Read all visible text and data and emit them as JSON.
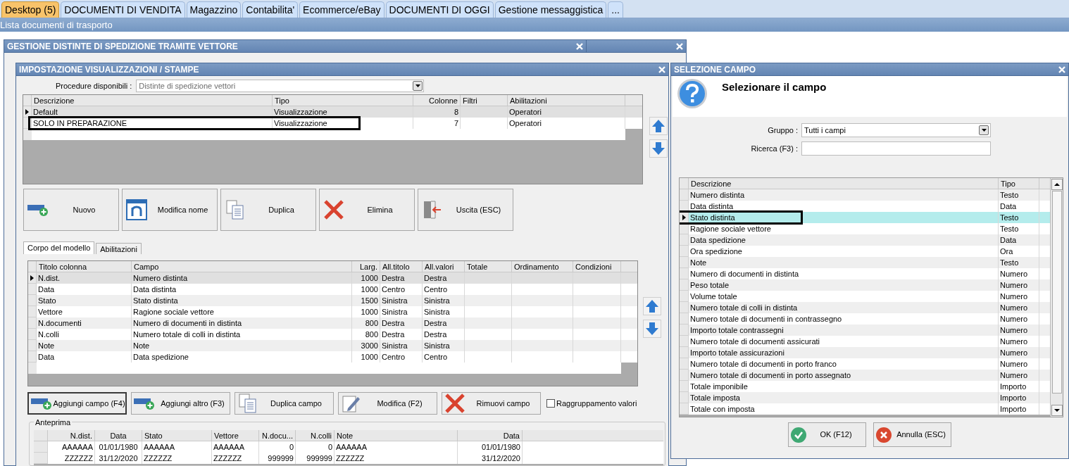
{
  "app_tabs": [
    {
      "label": "Desktop (5)",
      "selected": true
    },
    {
      "label": "DOCUMENTI DI VENDITA",
      "selected": false
    },
    {
      "label": "Magazzino",
      "selected": false
    },
    {
      "label": "Contabilita'",
      "selected": false
    },
    {
      "label": "Ecommerce/eBay",
      "selected": false
    },
    {
      "label": "DOCUMENTI DI OGGI",
      "selected": false
    },
    {
      "label": "Gestione messaggistica",
      "selected": false
    },
    {
      "label": "...",
      "selected": false
    }
  ],
  "subtitle": "Lista documenti di trasporto",
  "background_window": {
    "title": "GESTIONE DISTINTE DI SPEDIZIONE TRAMITE VETTORE"
  },
  "layout_dialog": {
    "title": "IMPOSTAZIONE VISUALIZZAZIONI / STAMPE",
    "procedure_label": "Procedure disponibili :",
    "procedure_value": "Distinte di spedizione vettori",
    "layouts": {
      "columns": [
        "Descrizione",
        "Tipo",
        "Colonne",
        "Filtri",
        "Abilitazioni"
      ],
      "rows": [
        {
          "cells": [
            "Default",
            "Visualizzazione",
            "8",
            "",
            "Operatori"
          ],
          "selected": true,
          "marked": false
        },
        {
          "cells": [
            "SOLO IN PREPARAZIONE",
            "Visualizzazione",
            "7",
            "",
            "Operatori"
          ],
          "selected": false,
          "marked": true
        }
      ]
    },
    "buttons": [
      "Nuovo",
      "Modifica nome",
      "Duplica",
      "Elimina",
      "Uscita (ESC)"
    ],
    "tabs": [
      {
        "label": "Corpo del modello",
        "selected": true
      },
      {
        "label": "Abilitazioni",
        "selected": false
      }
    ],
    "fields": {
      "columns": [
        "Titolo colonna",
        "Campo",
        "Larg.",
        "All.titolo",
        "All.valori",
        "Totale",
        "Ordinamento",
        "Condizioni"
      ],
      "rows": [
        {
          "cells": [
            "N.dist.",
            "Numero distinta",
            "1000",
            "Destra",
            "Destra",
            "",
            "",
            ""
          ],
          "selected": true
        },
        {
          "cells": [
            "Data",
            "Data distinta",
            "1000",
            "Centro",
            "Centro",
            "",
            "",
            ""
          ],
          "selected": false
        },
        {
          "cells": [
            "Stato",
            "Stato distinta",
            "1500",
            "Sinistra",
            "Sinistra",
            "",
            "",
            ""
          ],
          "selected": false
        },
        {
          "cells": [
            "Vettore",
            "Ragione sociale vettore",
            "1000",
            "Sinistra",
            "Sinistra",
            "",
            "",
            ""
          ],
          "selected": false
        },
        {
          "cells": [
            "N.documenti",
            "Numero di documenti in distinta",
            "800",
            "Destra",
            "Destra",
            "",
            "",
            ""
          ],
          "selected": false
        },
        {
          "cells": [
            "N.colli",
            "Numero totale di colli in distinta",
            "800",
            "Destra",
            "Destra",
            "",
            "",
            ""
          ],
          "selected": false
        },
        {
          "cells": [
            "Note",
            "Note",
            "3000",
            "Sinistra",
            "Sinistra",
            "",
            "",
            ""
          ],
          "selected": false
        },
        {
          "cells": [
            "Data",
            "Data spedizione",
            "1000",
            "Centro",
            "Centro",
            "",
            "",
            ""
          ],
          "selected": false
        }
      ]
    },
    "field_buttons": [
      {
        "label": "Aggiungi campo (F4)",
        "focused": true
      },
      {
        "label": "Aggiungi altro (F3)",
        "focused": false
      },
      {
        "label": "Duplica campo",
        "focused": false
      },
      {
        "label": "Modifica (F2)",
        "focused": false
      },
      {
        "label": "Rimuovi campo",
        "focused": false
      }
    ],
    "grouping": {
      "label": "Raggruppamento valori",
      "checked": false
    },
    "preview": {
      "title": "Anteprima",
      "columns": [
        "N.dist.",
        "Data",
        "Stato",
        "Vettore",
        "N.docu...",
        "N.colli",
        "Note",
        "Data"
      ],
      "rows": [
        {
          "cells": [
            "AAAAAA",
            "01/01/1980",
            "AAAAAA",
            "AAAAAA",
            "0",
            "0",
            "AAAAAA",
            "01/01/1980"
          ]
        },
        {
          "cells": [
            "ZZZZZZ",
            "31/12/2020",
            "ZZZZZZ",
            "ZZZZZZ",
            "999999",
            "999999",
            "ZZZZZZ",
            "31/12/2020"
          ]
        }
      ]
    }
  },
  "field_dialog": {
    "title": "SELEZIONE CAMPO",
    "heading": "Selezionare il campo",
    "group_label": "Gruppo :",
    "group_value": "Tutti i campi",
    "search_label": "Ricerca (F3) :",
    "list": {
      "columns": [
        "Descrizione",
        "Tipo"
      ],
      "rows": [
        {
          "cells": [
            "Numero distinta",
            "Testo"
          ],
          "selected": false,
          "marked": false
        },
        {
          "cells": [
            "Data distinta",
            "Data"
          ],
          "selected": false,
          "marked": false
        },
        {
          "cells": [
            "Stato distinta",
            "Testo"
          ],
          "selected": true,
          "marked": true
        },
        {
          "cells": [
            "Ragione sociale vettore",
            "Testo"
          ],
          "selected": false,
          "marked": false
        },
        {
          "cells": [
            "Data spedizione",
            "Data"
          ],
          "selected": false,
          "marked": false
        },
        {
          "cells": [
            "Ora spedizione",
            "Ora"
          ],
          "selected": false,
          "marked": false
        },
        {
          "cells": [
            "Note",
            "Testo"
          ],
          "selected": false,
          "marked": false
        },
        {
          "cells": [
            "Numero di documenti in distinta",
            "Numero"
          ],
          "selected": false,
          "marked": false
        },
        {
          "cells": [
            "Peso totale",
            "Numero"
          ],
          "selected": false,
          "marked": false
        },
        {
          "cells": [
            "Volume totale",
            "Numero"
          ],
          "selected": false,
          "marked": false
        },
        {
          "cells": [
            "Numero totale di colli in distinta",
            "Numero"
          ],
          "selected": false,
          "marked": false
        },
        {
          "cells": [
            "Numero totale di documenti in contrassegno",
            "Numero"
          ],
          "selected": false,
          "marked": false
        },
        {
          "cells": [
            "Importo totale contrassegni",
            "Numero"
          ],
          "selected": false,
          "marked": false
        },
        {
          "cells": [
            "Numero totale di documenti assicurati",
            "Numero"
          ],
          "selected": false,
          "marked": false
        },
        {
          "cells": [
            "Importo totale assicurazioni",
            "Numero"
          ],
          "selected": false,
          "marked": false
        },
        {
          "cells": [
            "Numero totale di documenti in porto franco",
            "Numero"
          ],
          "selected": false,
          "marked": false
        },
        {
          "cells": [
            "Numero totale di documenti in porto assegnato",
            "Numero"
          ],
          "selected": false,
          "marked": false
        },
        {
          "cells": [
            "Totale imponibile",
            "Importo"
          ],
          "selected": false,
          "marked": false
        },
        {
          "cells": [
            "Totale imposta",
            "Importo"
          ],
          "selected": false,
          "marked": false
        },
        {
          "cells": [
            "Totale con imposta",
            "Importo"
          ],
          "selected": false,
          "marked": false
        }
      ]
    },
    "buttons": [
      "OK (F12)",
      "Annulla (ESC)"
    ]
  }
}
